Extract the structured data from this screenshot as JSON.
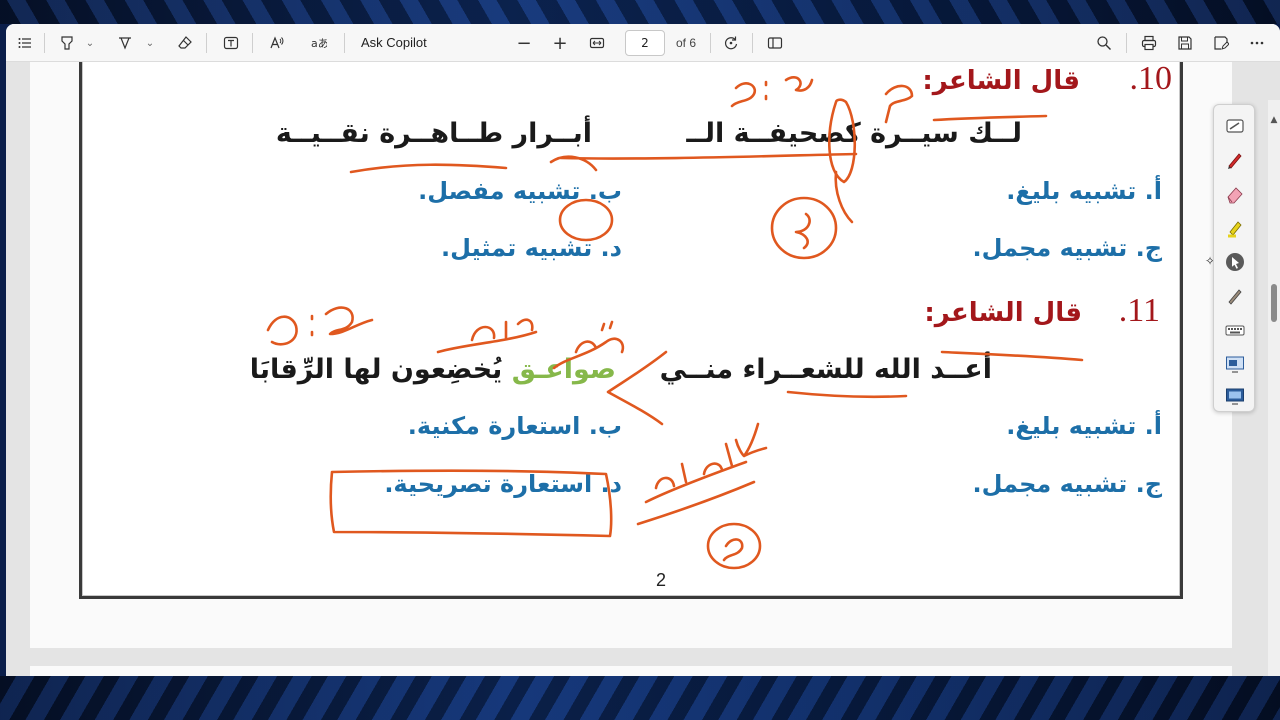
{
  "toolbar": {
    "ask_copilot_label": "Ask Copilot",
    "page_current": "2",
    "page_total_label": "of 6",
    "minus_label": "−",
    "plus_label": "+"
  },
  "document": {
    "q10": {
      "number": "10.",
      "label": "قال الشاعر:",
      "verse_right": "لــك سيــرة كصحيفــة الــ",
      "verse_left": "أبــرار طــاهــرة نقــيــة",
      "option_a": "أ. تشبيه بليغ.",
      "option_b": "ب. تشبيه مفصل.",
      "option_c": "ج. تشبيه مجمل.",
      "option_d": "د. تشبيه تمثيل."
    },
    "q11": {
      "number": "11.",
      "label": "قال الشاعر:",
      "verse_right": "أعــد الله للشعــراء منــي",
      "verse_left_green": "صواعـق",
      "verse_left_rest": "يُخضِعون لها الرِّقابَا",
      "option_a": "أ. تشبيه بليغ.",
      "option_b": "ب. استعارة مكنية.",
      "option_c": "ج. تشبيه مجمل.",
      "option_d": "د. استعارة تصريحية."
    },
    "page_number": "2"
  },
  "annotations": {
    "ink_color": "#e0581f",
    "note_q10_top": "م : ع",
    "note_q10_mim": "م",
    "note_q10_circle": "٢",
    "note_q11_top": "م : ع",
    "note_q11_kalam": "كلام",
    "note_q11_shi3r": "شعر",
    "note_q11_hija": "هجاء",
    "note_q11_circle": "م"
  },
  "colors": {
    "question_number": "#a3171b",
    "options": "#1d6fa8",
    "highlight_green": "#86b84a",
    "ink": "#e0581f"
  }
}
